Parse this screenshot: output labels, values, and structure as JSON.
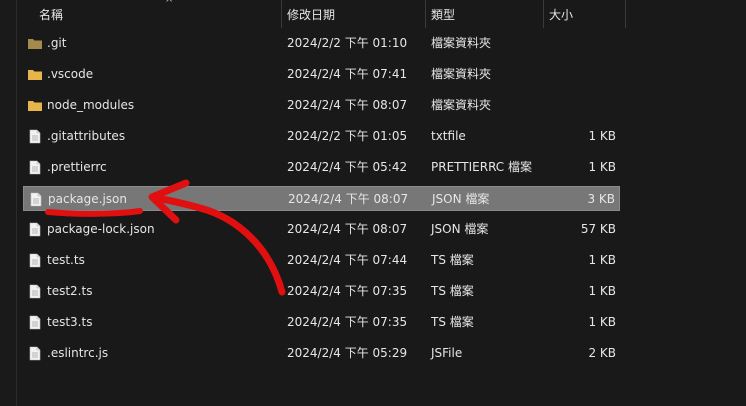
{
  "header": {
    "name_label": "名稱",
    "date_label": "修改日期",
    "type_label": "類型",
    "size_label": "大小",
    "sort_arrow": "^"
  },
  "colors": {
    "background": "#191919",
    "selection": "#777777",
    "folder": "#e8b54a",
    "git_folder": "#a58a4e",
    "annotation": "#e01010"
  },
  "files": [
    {
      "name": ".git",
      "date": "2024/2/2 下午 01:10",
      "type": "檔案資料夾",
      "size": "",
      "icon": "folder-icon",
      "kind": "git-folder",
      "selected": false
    },
    {
      "name": ".vscode",
      "date": "2024/2/4 下午 07:41",
      "type": "檔案資料夾",
      "size": "",
      "icon": "folder-icon",
      "kind": "folder",
      "selected": false
    },
    {
      "name": "node_modules",
      "date": "2024/2/4 下午 08:07",
      "type": "檔案資料夾",
      "size": "",
      "icon": "folder-icon",
      "kind": "folder",
      "selected": false
    },
    {
      "name": ".gitattributes",
      "date": "2024/2/2 下午 01:05",
      "type": "txtfile",
      "size": "1 KB",
      "icon": "file-icon",
      "kind": "file",
      "selected": false
    },
    {
      "name": ".prettierrc",
      "date": "2024/2/4 下午 05:42",
      "type": "PRETTIERRC 檔案",
      "size": "1 KB",
      "icon": "file-icon",
      "kind": "file",
      "selected": false
    },
    {
      "name": "package.json",
      "date": "2024/2/4 下午 08:07",
      "type": "JSON 檔案",
      "size": "3 KB",
      "icon": "file-icon",
      "kind": "file",
      "selected": true
    },
    {
      "name": "package-lock.json",
      "date": "2024/2/4 下午 08:07",
      "type": "JSON 檔案",
      "size": "57 KB",
      "icon": "file-icon",
      "kind": "file",
      "selected": false
    },
    {
      "name": "test.ts",
      "date": "2024/2/4 下午 07:44",
      "type": "TS 檔案",
      "size": "1 KB",
      "icon": "file-icon",
      "kind": "file",
      "selected": false
    },
    {
      "name": "test2.ts",
      "date": "2024/2/4 下午 07:35",
      "type": "TS 檔案",
      "size": "1 KB",
      "icon": "file-icon",
      "kind": "file",
      "selected": false
    },
    {
      "name": "test3.ts",
      "date": "2024/2/4 下午 07:35",
      "type": "TS 檔案",
      "size": "1 KB",
      "icon": "file-icon",
      "kind": "file",
      "selected": false
    },
    {
      "name": ".eslintrc.js",
      "date": "2024/2/4 下午 05:29",
      "type": "JSFile",
      "size": "2 KB",
      "icon": "file-icon",
      "kind": "file",
      "selected": false
    }
  ],
  "annotation": {
    "type": "hand-drawn-arrow",
    "icon": "red-arrow-icon",
    "points_to": "package.json"
  }
}
